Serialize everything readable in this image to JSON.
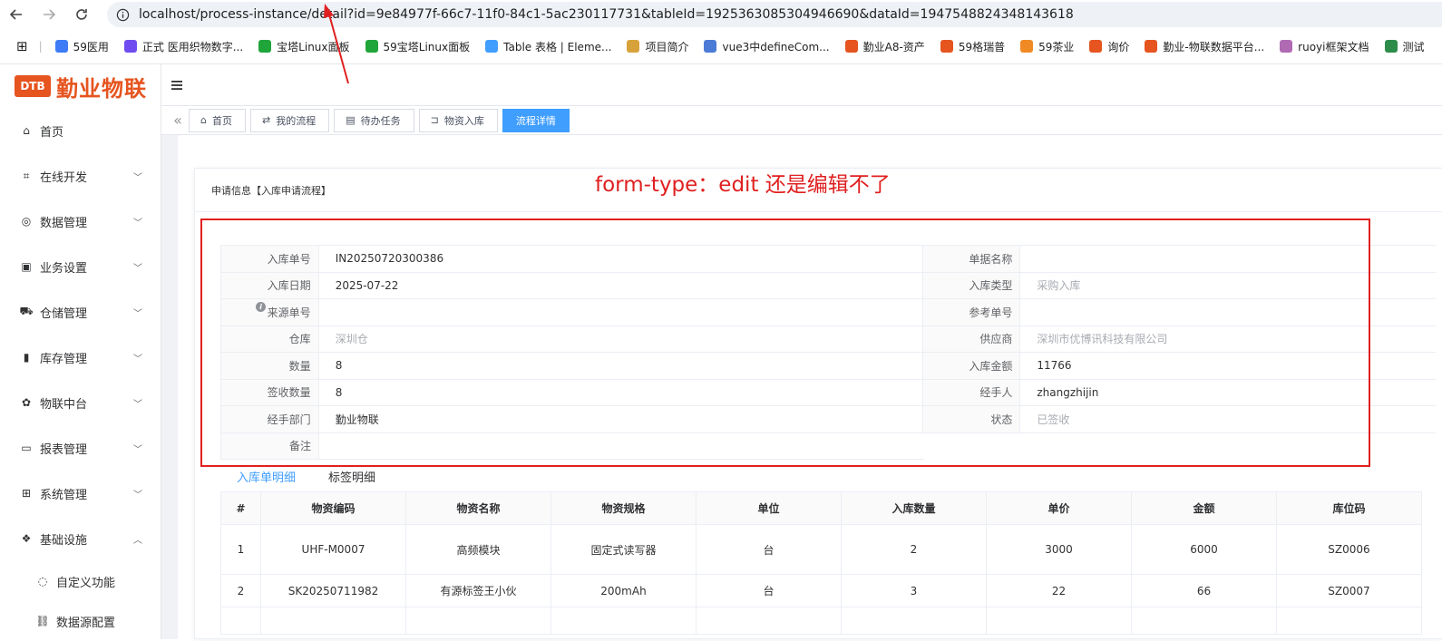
{
  "browser": {
    "url": "localhost/process-instance/detail?id=9e84977f-66c7-11f0-84c1-5ac230117731&tableId=1925363085304946690&dataId=1947548824348143618",
    "bookmarks": [
      {
        "label": "59医用",
        "color": "#3d7bf7"
      },
      {
        "label": "正式 医用织物数字...",
        "color": "#6f4cf0"
      },
      {
        "label": "宝塔Linux面板",
        "color": "#20a53a"
      },
      {
        "label": "59宝塔Linux面板",
        "color": "#20a53a"
      },
      {
        "label": "Table 表格 | Eleme...",
        "color": "#409eff"
      },
      {
        "label": "项目简介",
        "color": "#d8a23b"
      },
      {
        "label": "vue3中defineCom...",
        "color": "#4b7bd6"
      },
      {
        "label": "勤业A8-资产",
        "color": "#e6541f"
      },
      {
        "label": "59格瑞普",
        "color": "#e6541f"
      },
      {
        "label": "59茶业",
        "color": "#f08a24"
      },
      {
        "label": "询价",
        "color": "#e6541f"
      },
      {
        "label": "勤业-物联数据平台...",
        "color": "#e6541f"
      },
      {
        "label": "ruoyi框架文档",
        "color": "#b06ab3"
      },
      {
        "label": "测试",
        "color": "#2d8c4a"
      }
    ]
  },
  "sidebar": {
    "logo_mark": "DTB",
    "logo_text": "勤业物联",
    "items": [
      {
        "label": "首页",
        "icon": "home-icon",
        "glyph": "⌂",
        "expandable": false
      },
      {
        "label": "在线开发",
        "icon": "dev-icon",
        "glyph": "⌗",
        "expandable": true
      },
      {
        "label": "数据管理",
        "icon": "data-icon",
        "glyph": "◎",
        "expandable": true
      },
      {
        "label": "业务设置",
        "icon": "business-icon",
        "glyph": "▣",
        "expandable": true
      },
      {
        "label": "仓储管理",
        "icon": "warehouse-icon",
        "glyph": "⛟",
        "expandable": true
      },
      {
        "label": "库存管理",
        "icon": "stock-icon",
        "glyph": "▮",
        "expandable": true
      },
      {
        "label": "物联中台",
        "icon": "iot-icon",
        "glyph": "✿",
        "expandable": true
      },
      {
        "label": "报表管理",
        "icon": "report-icon",
        "glyph": "▭",
        "expandable": true
      },
      {
        "label": "系统管理",
        "icon": "system-icon",
        "glyph": "⊞",
        "expandable": true
      },
      {
        "label": "基础设施",
        "icon": "infra-icon",
        "glyph": "❖",
        "expandable": true,
        "expanded": true
      }
    ],
    "subitems": [
      {
        "label": "自定义功能",
        "icon": "custom-function-icon",
        "glyph": "◌"
      },
      {
        "label": "数据源配置",
        "icon": "datasource-icon",
        "glyph": "⛓"
      }
    ]
  },
  "tags": [
    {
      "label": "首页",
      "icon": "home-icon",
      "glyph": "⌂",
      "active": false
    },
    {
      "label": "我的流程",
      "icon": "flow-icon",
      "glyph": "⇄",
      "active": false
    },
    {
      "label": "待办任务",
      "icon": "todo-icon",
      "glyph": "▤",
      "active": false
    },
    {
      "label": "物资入库",
      "icon": "cart-icon",
      "glyph": "⊐",
      "active": false
    },
    {
      "label": "流程详情",
      "icon": "",
      "glyph": "",
      "active": true
    }
  ],
  "card": {
    "title": "申请信息【入库申请流程】"
  },
  "form": {
    "left": [
      {
        "label": "入库单号",
        "value": "IN20250720300386",
        "muted": false
      },
      {
        "label": "入库日期",
        "value": "2025-07-22",
        "muted": false
      },
      {
        "label": "来源单号",
        "value": "",
        "muted": false,
        "info": true
      },
      {
        "label": "仓库",
        "value": "深圳仓",
        "muted": true
      },
      {
        "label": "数量",
        "value": "8",
        "muted": false
      },
      {
        "label": "签收数量",
        "value": "8",
        "muted": false
      },
      {
        "label": "经手部门",
        "value": "勤业物联",
        "muted": false
      },
      {
        "label": "备注",
        "value": "",
        "muted": false
      }
    ],
    "right": [
      {
        "label": "单据名称",
        "value": "",
        "muted": false
      },
      {
        "label": "入库类型",
        "value": "采购入库",
        "muted": true
      },
      {
        "label": "参考单号",
        "value": "",
        "muted": false
      },
      {
        "label": "供应商",
        "value": "深圳市优博讯科技有限公司",
        "muted": true
      },
      {
        "label": "入库金额",
        "value": "11766",
        "muted": false
      },
      {
        "label": "经手人",
        "value": "zhangzhijin",
        "muted": false
      },
      {
        "label": "状态",
        "value": "已签收",
        "muted": true
      }
    ]
  },
  "tabs": [
    {
      "label": "入库单明细",
      "active": true
    },
    {
      "label": "标签明细",
      "active": false
    }
  ],
  "table": {
    "columns": [
      "#",
      "物资编码",
      "物资名称",
      "物资规格",
      "单位",
      "入库数量",
      "单价",
      "金额",
      "库位码"
    ],
    "rows": [
      [
        "1",
        "UHF-M0007",
        "高频模块",
        "固定式读写器",
        "台",
        "2",
        "3000",
        "6000",
        "SZ0006"
      ],
      [
        "2",
        "SK20250711982",
        "有源标签王小伙",
        "200mAh",
        "台",
        "3",
        "22",
        "66",
        "SZ0007"
      ]
    ]
  },
  "annotation": {
    "text": "form-type：edit  还是编辑不了",
    "color": "#e02020"
  }
}
